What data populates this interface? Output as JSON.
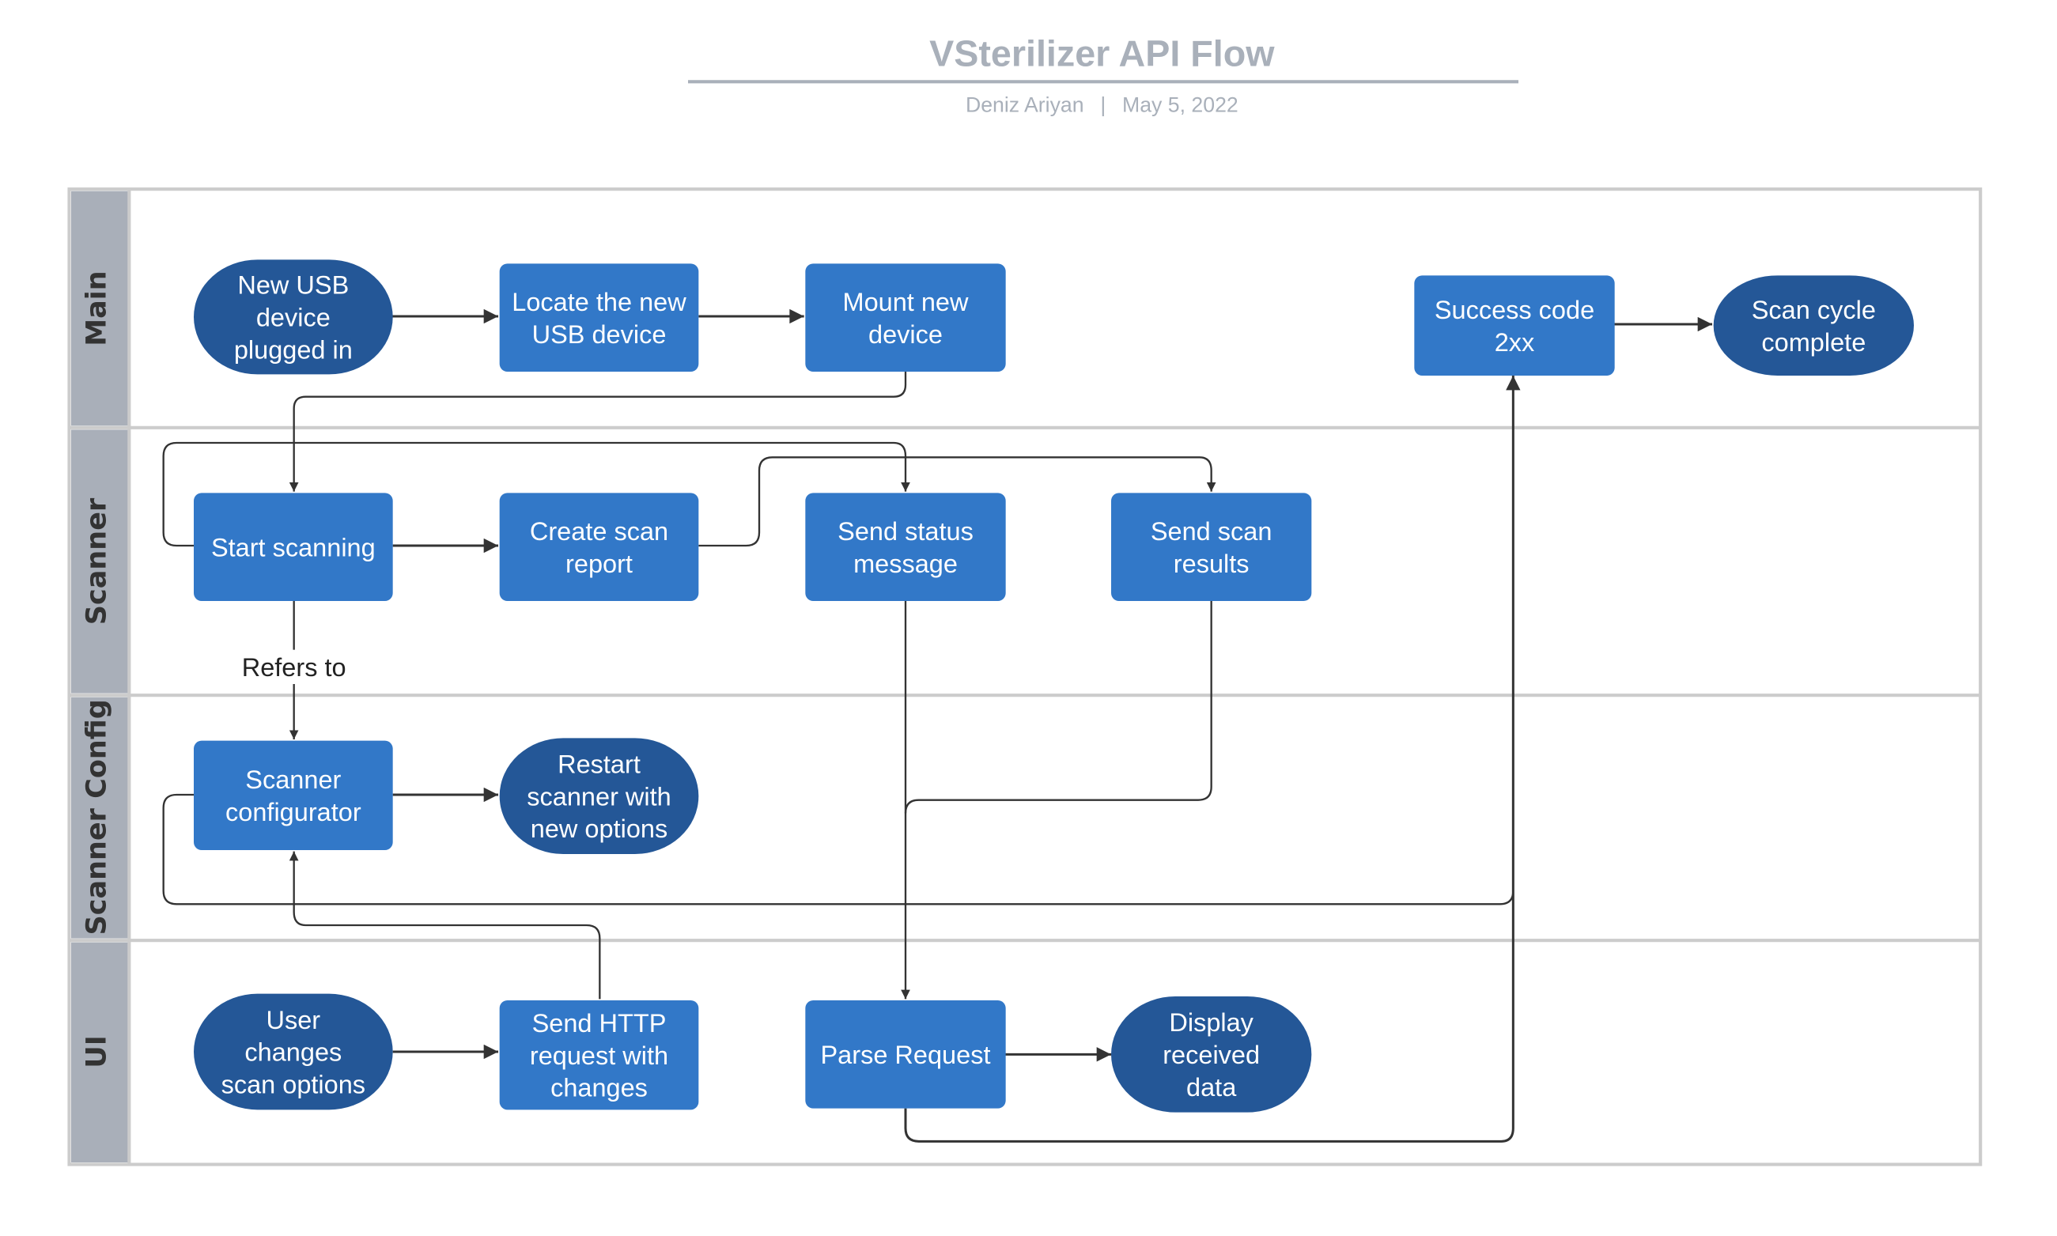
{
  "document": {
    "title": "VSterilizer API Flow",
    "author": "Deniz Ariyan",
    "separator": "|",
    "date": "May 5, 2022"
  },
  "colors": {
    "process": "#3278c8",
    "terminal": "#245797",
    "lane_header": "#a9afb9",
    "title": "#a9b0ba",
    "edge": "#333333"
  },
  "lanes": [
    {
      "id": "main",
      "label": "Main"
    },
    {
      "id": "scanner",
      "label": "Scanner"
    },
    {
      "id": "scanner_config",
      "label": "Scanner Config"
    },
    {
      "id": "ui",
      "label": "UI"
    }
  ],
  "nodes": {
    "new_usb": {
      "type": "terminal",
      "lines": [
        "New USB",
        "device",
        "plugged in"
      ]
    },
    "locate_usb": {
      "type": "process",
      "lines": [
        "Locate the new",
        "USB device"
      ]
    },
    "mount_device": {
      "type": "process",
      "lines": [
        "Mount new",
        "device"
      ]
    },
    "success_code": {
      "type": "process",
      "lines": [
        "Success code",
        "2xx"
      ]
    },
    "scan_complete": {
      "type": "terminal",
      "lines": [
        "Scan cycle",
        "complete"
      ]
    },
    "start_scanning": {
      "type": "process",
      "lines": [
        "Start scanning"
      ]
    },
    "create_report": {
      "type": "process",
      "lines": [
        "Create scan",
        "report"
      ]
    },
    "send_status": {
      "type": "process",
      "lines": [
        "Send status",
        "message"
      ]
    },
    "send_results": {
      "type": "process",
      "lines": [
        "Send scan",
        "results"
      ]
    },
    "scanner_configurator": {
      "type": "process",
      "lines": [
        "Scanner",
        "configurator"
      ]
    },
    "restart_scanner": {
      "type": "terminal",
      "lines": [
        "Restart",
        "scanner with",
        "new options"
      ]
    },
    "user_changes": {
      "type": "terminal",
      "lines": [
        "User",
        "changes",
        "scan options"
      ]
    },
    "send_http": {
      "type": "process",
      "lines": [
        "Send HTTP",
        "request with",
        "changes"
      ]
    },
    "parse_request": {
      "type": "process",
      "lines": [
        "Parse Request"
      ]
    },
    "display_data": {
      "type": "terminal",
      "lines": [
        "Display",
        "received",
        "data"
      ]
    }
  },
  "edges": [
    {
      "from": "new_usb",
      "to": "locate_usb"
    },
    {
      "from": "locate_usb",
      "to": "mount_device"
    },
    {
      "from": "mount_device",
      "to": "start_scanning"
    },
    {
      "from": "success_code",
      "to": "scan_complete"
    },
    {
      "from": "start_scanning",
      "to": "create_report"
    },
    {
      "from": "start_scanning",
      "to": "send_status"
    },
    {
      "from": "create_report",
      "to": "send_results"
    },
    {
      "from": "start_scanning",
      "to": "scanner_configurator",
      "label": "Refers to"
    },
    {
      "from": "send_status",
      "to": "parse_request"
    },
    {
      "from": "send_results",
      "to": "parse_request"
    },
    {
      "from": "scanner_configurator",
      "to": "restart_scanner"
    },
    {
      "from": "scanner_configurator",
      "to": "success_code"
    },
    {
      "from": "send_http",
      "to": "scanner_configurator"
    },
    {
      "from": "user_changes",
      "to": "send_http"
    },
    {
      "from": "parse_request",
      "to": "display_data"
    },
    {
      "from": "parse_request",
      "to": "success_code"
    }
  ]
}
